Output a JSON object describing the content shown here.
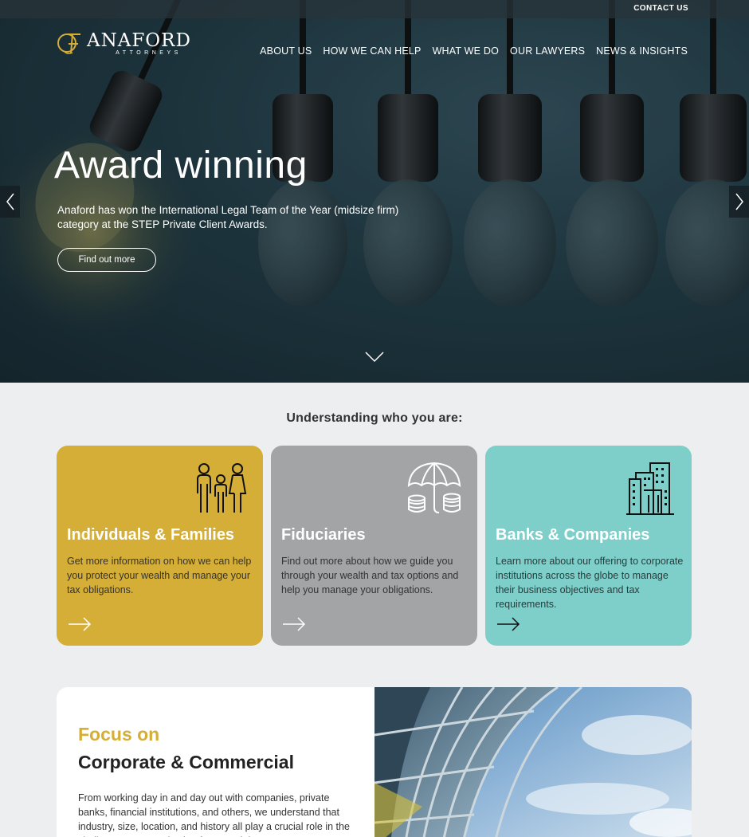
{
  "topbar": {
    "contact_label": "CONTACT US"
  },
  "logo": {
    "name": "ANAFORD",
    "sub": "ATTORNEYS"
  },
  "nav": {
    "items": [
      {
        "label": "ABOUT US"
      },
      {
        "label": "HOW WE CAN HELP"
      },
      {
        "label": "WHAT WE DO"
      },
      {
        "label": "OUR LAWYERS"
      },
      {
        "label": "NEWS & INSIGHTS"
      }
    ]
  },
  "hero": {
    "title": "Award winning",
    "text": "Anaford has won the International Legal Team of the Year (midsize firm) category at the STEP Private Client Awards.",
    "button_label": "Find out more"
  },
  "understanding": {
    "title": "Understanding who you are:",
    "cards": [
      {
        "title": "Individuals & Families",
        "desc": "Get more information on how we can help you protect your wealth and manage your tax obligations.",
        "icon": "family-icon",
        "color": "#d4ae36"
      },
      {
        "title": "Fiduciaries",
        "desc": "Find out more about how we guide you through your wealth and tax options and help you manage your obligations.",
        "icon": "umbrella-coins-icon",
        "color": "#a3a4a6"
      },
      {
        "title": "Banks & Companies",
        "desc": "Learn more about our offering to corporate institutions across the globe to manage their business objectives and tax requirements.",
        "icon": "buildings-icon",
        "color": "#7ecfca"
      }
    ]
  },
  "focus": {
    "kicker": "Focus on",
    "title": "Corporate & Commercial",
    "text": "From working day in and day out with companies, private banks, financial institutions, and others, we understand that industry, size, location, and history all play a crucial role in the challenges an organisation faces and the"
  },
  "colors": {
    "gold": "#d4ae36",
    "grey": "#a3a4a6",
    "teal": "#7ecfca"
  }
}
